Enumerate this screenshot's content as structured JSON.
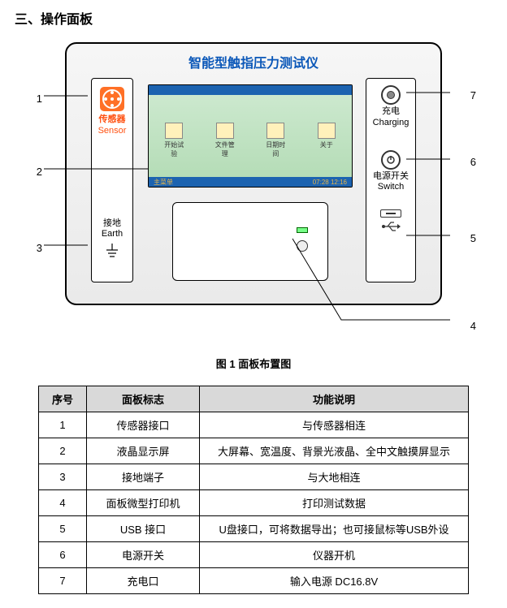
{
  "section_title": "三、操作面板",
  "device": {
    "title": "智能型触指压力测试仪",
    "sensor_label_cn": "传感器",
    "sensor_label_en": "Sensor",
    "earth_label_cn": "接地",
    "earth_label_en": "Earth",
    "charge_label_cn": "充电",
    "charge_label_en": "Charging",
    "switch_label_cn": "电源开关",
    "switch_label_en": "Switch",
    "screen_icons": [
      "开始试验",
      "文件管理",
      "日期时间",
      "关于"
    ],
    "screen_status_left": "主菜单",
    "screen_status_right": "07:28  12:16"
  },
  "callouts": {
    "n1": "1",
    "n2": "2",
    "n3": "3",
    "n4": "4",
    "n5": "5",
    "n6": "6",
    "n7": "7"
  },
  "caption": "图 1 面板布置图",
  "table": {
    "headers": {
      "seq": "序号",
      "mark": "面板标志",
      "func": "功能说明"
    },
    "rows": [
      {
        "seq": "1",
        "mark": "传感器接口",
        "func": "与传感器相连"
      },
      {
        "seq": "2",
        "mark": "液晶显示屏",
        "func": "大屏幕、宽温度、背景光液晶、全中文触摸屏显示"
      },
      {
        "seq": "3",
        "mark": "接地端子",
        "func": "与大地相连"
      },
      {
        "seq": "4",
        "mark": "面板微型打印机",
        "func": "打印测试数据"
      },
      {
        "seq": "5",
        "mark": "USB 接口",
        "func": "U盘接口，可将数据导出；也可接鼠标等USB外设"
      },
      {
        "seq": "6",
        "mark": "电源开关",
        "func": "仪器开机"
      },
      {
        "seq": "7",
        "mark": "充电口",
        "func": "输入电源 DC16.8V"
      }
    ]
  },
  "chart_data": {
    "type": "table",
    "title": "图 1 面板布置图 — 面板说明",
    "columns": [
      "序号",
      "面板标志",
      "功能说明"
    ],
    "rows": [
      [
        "1",
        "传感器接口",
        "与传感器相连"
      ],
      [
        "2",
        "液晶显示屏",
        "大屏幕、宽温度、背景光液晶、全中文触摸屏显示"
      ],
      [
        "3",
        "接地端子",
        "与大地相连"
      ],
      [
        "4",
        "面板微型打印机",
        "打印测试数据"
      ],
      [
        "5",
        "USB 接口",
        "U盘接口，可将数据导出；也可接鼠标等USB外设"
      ],
      [
        "6",
        "电源开关",
        "仪器开机"
      ],
      [
        "7",
        "充电口",
        "输入电源 DC16.8V"
      ]
    ]
  }
}
